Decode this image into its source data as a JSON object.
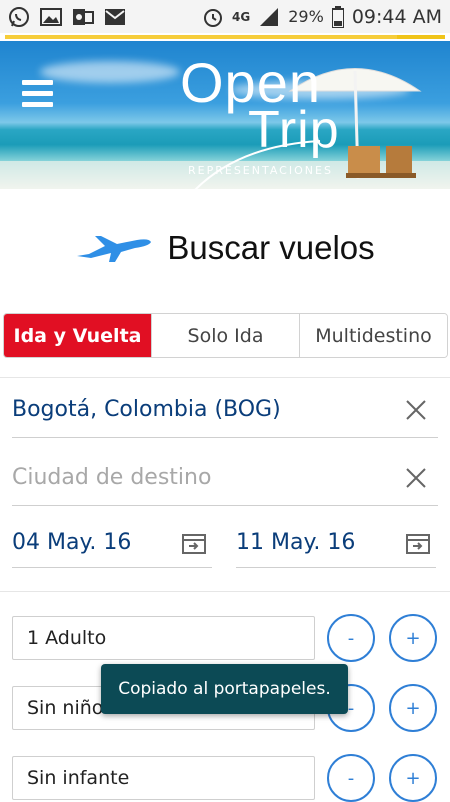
{
  "status_bar": {
    "network": "4G",
    "battery": "29%",
    "time": "09:44 AM",
    "icons": [
      "whatsapp-icon",
      "gallery-icon",
      "outlook-icon",
      "mail-icon",
      "alarm-icon",
      "signal-icon",
      "battery-icon"
    ]
  },
  "header": {
    "logo_line1": "Open",
    "logo_line2": "Trip",
    "logo_sub": "REPRESENTACIONES"
  },
  "page": {
    "title": "Buscar vuelos"
  },
  "tabs": [
    {
      "label": "Ida y Vuelta",
      "active": true
    },
    {
      "label": "Solo Ida",
      "active": false
    },
    {
      "label": "Multidestino",
      "active": false
    }
  ],
  "origin": {
    "value": "Bogotá, Colombia (BOG)",
    "placeholder": ""
  },
  "destination": {
    "value": "",
    "placeholder": "Ciudad de destino"
  },
  "dates": {
    "depart": "04 May. 16",
    "return": "11 May. 16"
  },
  "passengers": [
    {
      "label": "1 Adulto",
      "minus": "-",
      "plus": "+"
    },
    {
      "label": "Sin niño",
      "minus": "-",
      "plus": "+"
    },
    {
      "label": "Sin infante",
      "minus": "-",
      "plus": "+"
    }
  ],
  "toast": {
    "text": "Copiado al portapapeles."
  },
  "colors": {
    "accent_red": "#e10f23",
    "accent_blue": "#2f7fd6",
    "text_blue": "#0a3d7a",
    "toast_bg": "#0c4a55"
  }
}
